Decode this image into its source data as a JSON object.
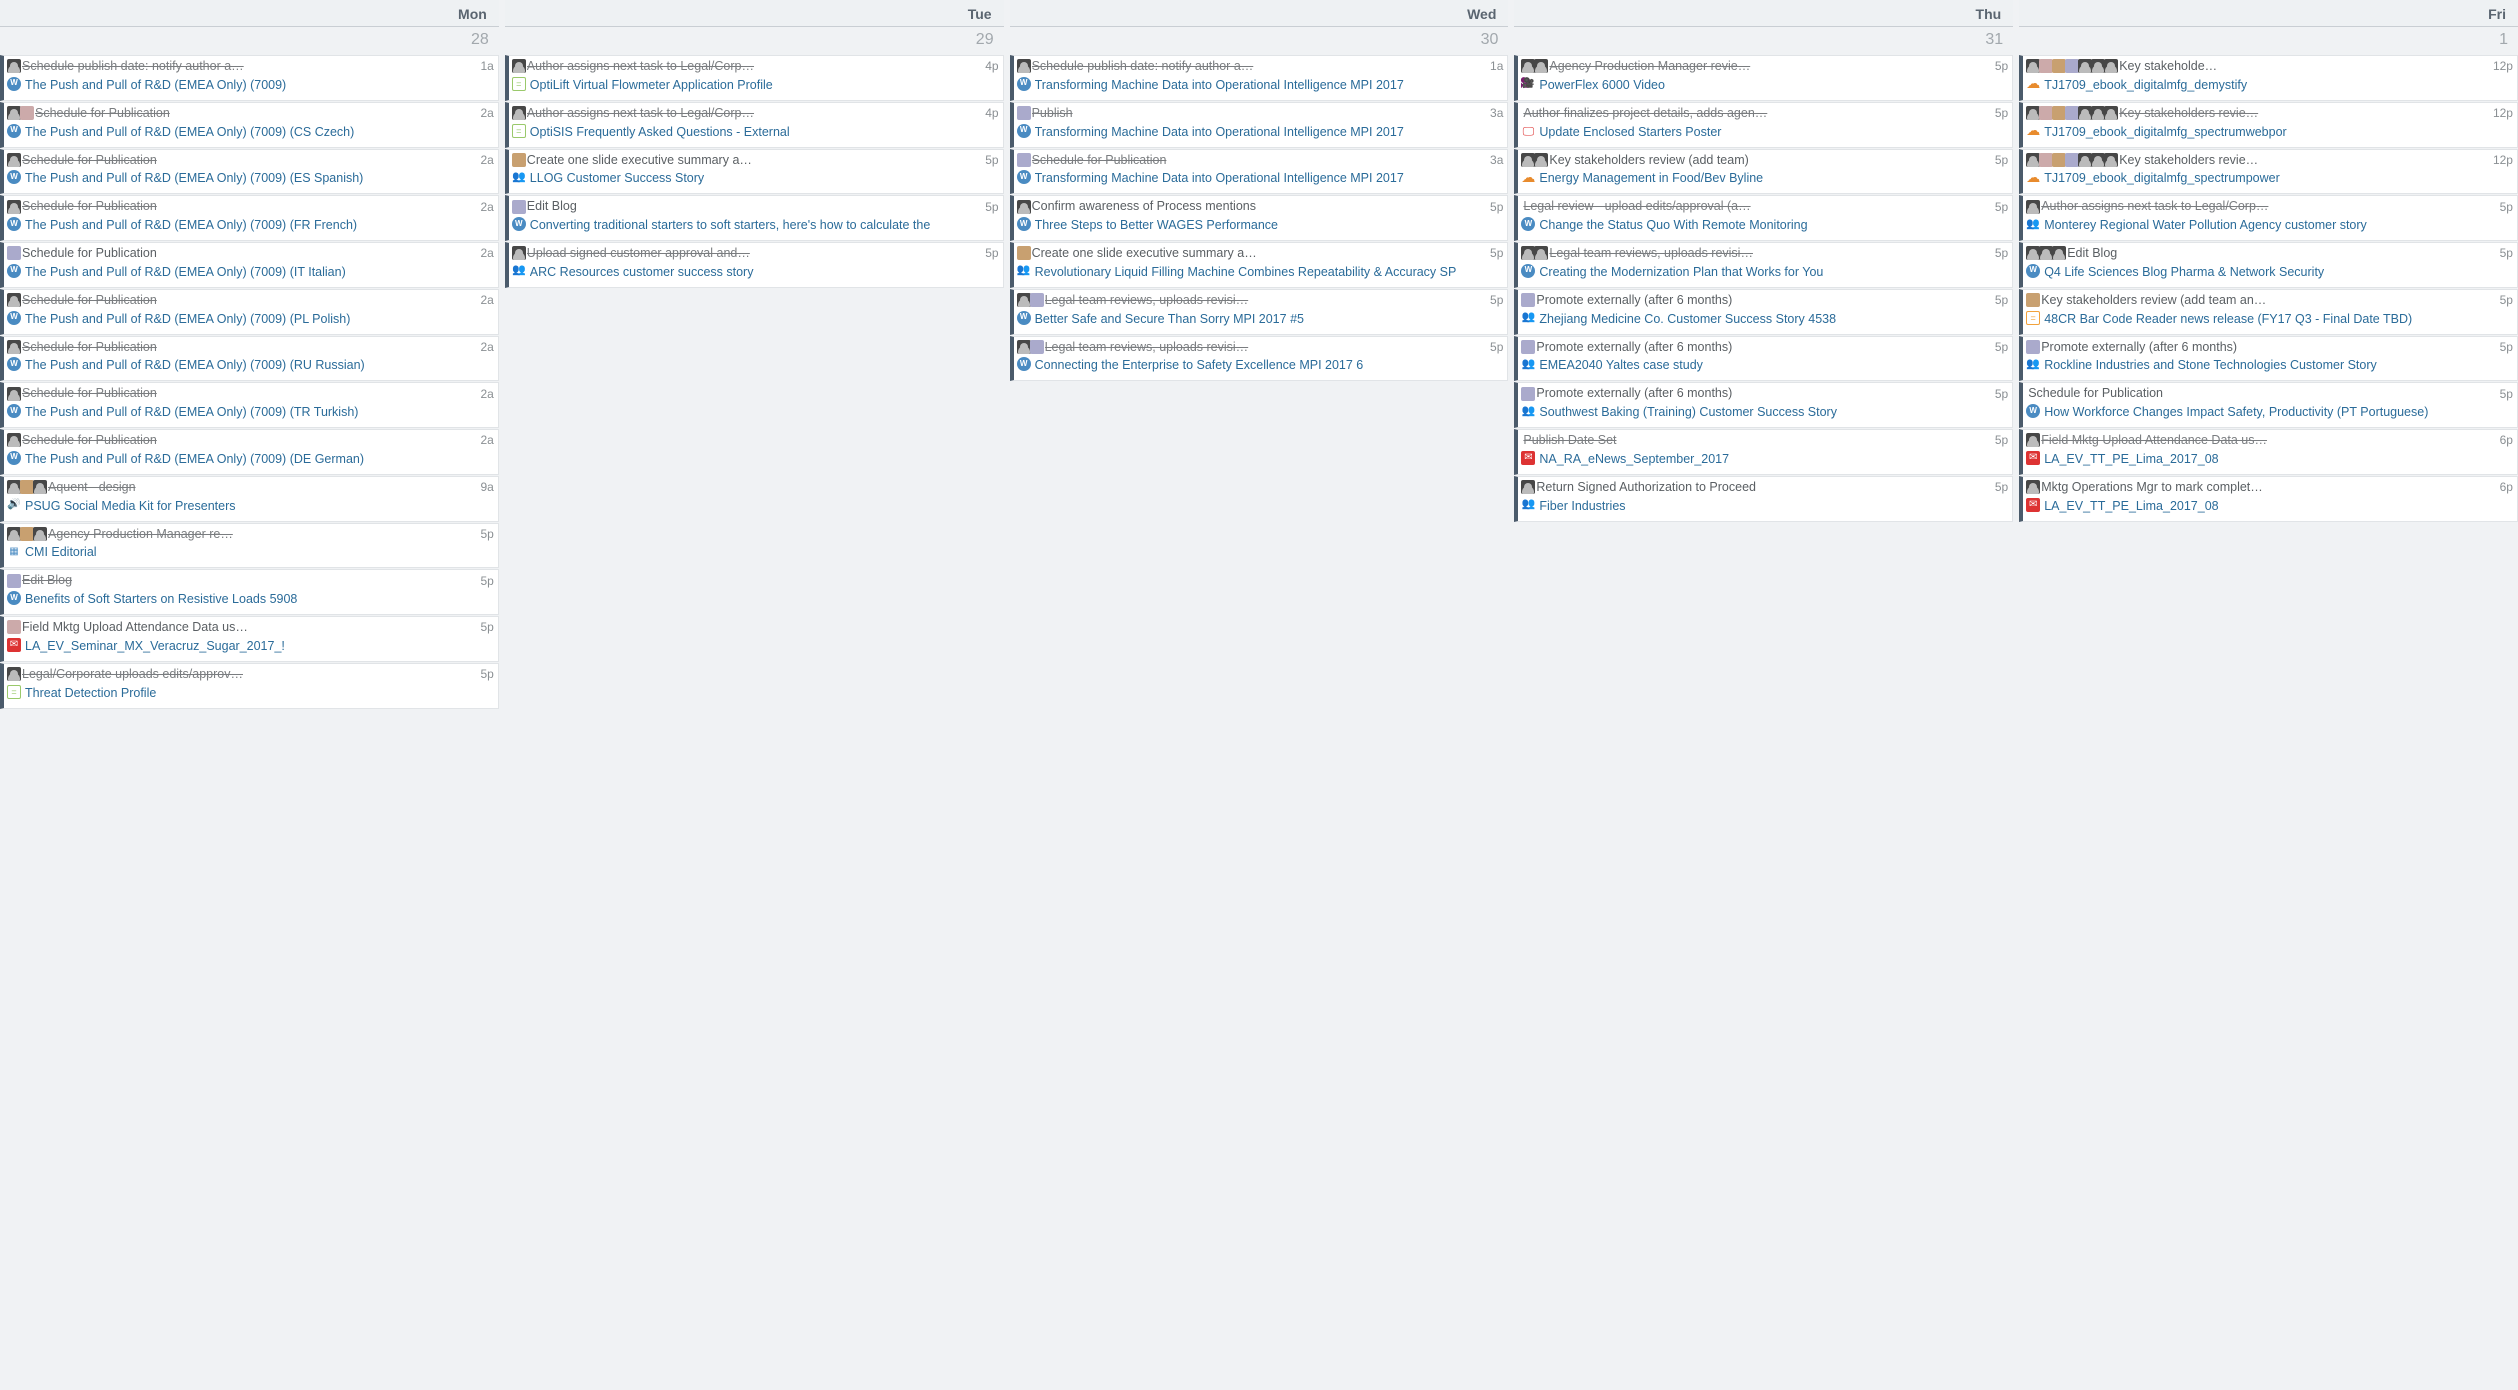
{
  "days": [
    {
      "name": "Mon",
      "date": "28",
      "events": [
        {
          "avatars": [
            "avph"
          ],
          "title": "Schedule publish date: notify author a…",
          "struck": true,
          "time": "1a",
          "sub_icon": "ic-wp",
          "sub": "The Push and Pull of R&D (EMEA Only) (7009)"
        },
        {
          "avatars": [
            "avph",
            "av2"
          ],
          "title": "Schedule for Publication",
          "struck": true,
          "time": "2a",
          "sub_icon": "ic-wp",
          "sub": "The Push and Pull of R&D (EMEA Only) (7009) (CS Czech)"
        },
        {
          "avatars": [
            "avph"
          ],
          "title": "Schedule for Publication",
          "struck": true,
          "time": "2a",
          "sub_icon": "ic-wp",
          "sub": "The Push and Pull of R&D (EMEA Only) (7009) (ES Spanish)"
        },
        {
          "avatars": [
            "avph"
          ],
          "title": "Schedule for Publication",
          "struck": true,
          "time": "2a",
          "sub_icon": "ic-wp",
          "sub": "The Push and Pull of R&D (EMEA Only) (7009) (FR French)"
        },
        {
          "avatars": [
            "av3"
          ],
          "title": "Schedule for Publication",
          "struck": false,
          "time": "2a",
          "sub_icon": "ic-wp",
          "sub": "The Push and Pull of R&D (EMEA Only) (7009) (IT Italian)"
        },
        {
          "avatars": [
            "avph"
          ],
          "title": "Schedule for Publication",
          "struck": true,
          "time": "2a",
          "sub_icon": "ic-wp",
          "sub": "The Push and Pull of R&D (EMEA Only) (7009) (PL Polish)"
        },
        {
          "avatars": [
            "avph"
          ],
          "title": "Schedule for Publication",
          "struck": true,
          "time": "2a",
          "sub_icon": "ic-wp",
          "sub": "The Push and Pull of R&D (EMEA Only) (7009) (RU Russian)"
        },
        {
          "avatars": [
            "avph"
          ],
          "title": "Schedule for Publication",
          "struck": true,
          "time": "2a",
          "sub_icon": "ic-wp",
          "sub": "The Push and Pull of R&D (EMEA Only) (7009) (TR Turkish)"
        },
        {
          "avatars": [
            "avph"
          ],
          "title": "Schedule for Publication",
          "struck": true,
          "time": "2a",
          "sub_icon": "ic-wp",
          "sub": "The Push and Pull of R&D (EMEA Only) (7009) (DE German)"
        },
        {
          "avatars": [
            "avph",
            "av5",
            "avph"
          ],
          "title": "Aquent - design",
          "struck": true,
          "time": "9a",
          "sub_icon": "ic-sound",
          "sub": "PSUG Social Media Kit for Presenters"
        },
        {
          "avatars": [
            "avph",
            "av5",
            "avph"
          ],
          "title": "Agency Production Manager re…",
          "struck": true,
          "time": "5p",
          "sub_icon": "ic-cal",
          "sub": "CMI Editorial"
        },
        {
          "avatars": [
            "av3"
          ],
          "title": "Edit Blog",
          "struck": true,
          "time": "5p",
          "sub_icon": "ic-wp",
          "sub": "Benefits of Soft Starters on Resistive Loads 5908"
        },
        {
          "avatars": [
            "av2"
          ],
          "title": "Field Mktg Upload Attendance Data us…",
          "struck": false,
          "time": "5p",
          "sub_icon": "ic-mail",
          "sub": "LA_EV_Seminar_MX_Veracruz_Sugar_2017_!"
        },
        {
          "avatars": [
            "avph"
          ],
          "title": "Legal/Corporate uploads edits/approv…",
          "struck": true,
          "time": "5p",
          "sub_icon": "ic-doc",
          "sub": "Threat Detection Profile"
        }
      ]
    },
    {
      "name": "Tue",
      "date": "29",
      "events": [
        {
          "avatars": [
            "avph"
          ],
          "title": "Author assigns next task to Legal/Corp…",
          "struck": true,
          "time": "4p",
          "sub_icon": "ic-doc",
          "sub": "OptiLift Virtual Flowmeter Application Profile"
        },
        {
          "avatars": [
            "avph"
          ],
          "title": "Author assigns next task to Legal/Corp…",
          "struck": true,
          "time": "4p",
          "sub_icon": "ic-doc",
          "sub": "OptiSIS Frequently Asked Questions - External"
        },
        {
          "avatars": [
            "av5"
          ],
          "title": "Create one slide executive summary a…",
          "struck": false,
          "time": "5p",
          "sub_icon": "ic-group",
          "sub": "LLOG Customer Success Story"
        },
        {
          "avatars": [
            "av3"
          ],
          "title": "Edit Blog",
          "struck": false,
          "time": "5p",
          "sub_icon": "ic-wp",
          "sub": "Converting traditional starters to soft starters, here's how to calculate the"
        },
        {
          "avatars": [
            "avph"
          ],
          "title": "Upload signed customer approval and…",
          "struck": true,
          "time": "5p",
          "sub_icon": "ic-group",
          "sub": "ARC Resources customer success story"
        }
      ]
    },
    {
      "name": "Wed",
      "date": "30",
      "events": [
        {
          "avatars": [
            "avph"
          ],
          "title": "Schedule publish date: notify author a…",
          "struck": true,
          "time": "1a",
          "sub_icon": "ic-wp",
          "sub": "Transforming Machine Data into Operational Intelligence MPI 2017"
        },
        {
          "avatars": [
            "av3"
          ],
          "title": "Publish",
          "struck": true,
          "time": "3a",
          "sub_icon": "ic-wp",
          "sub": "Transforming Machine Data into Operational Intelligence MPI 2017"
        },
        {
          "avatars": [
            "av3"
          ],
          "title": "Schedule for Publication",
          "struck": true,
          "time": "3a",
          "sub_icon": "ic-wp",
          "sub": "Transforming Machine Data into Operational Intelligence MPI 2017"
        },
        {
          "avatars": [
            "avph"
          ],
          "title": "Confirm awareness of Process mentions",
          "struck": false,
          "time": "5p",
          "sub_icon": "ic-wp",
          "sub": "Three Steps to Better WAGES Performance"
        },
        {
          "avatars": [
            "av5"
          ],
          "title": "Create one slide executive summary a…",
          "struck": false,
          "time": "5p",
          "sub_icon": "ic-group",
          "sub": "Revolutionary Liquid Filling Machine Combines Repeatability & Accuracy SP"
        },
        {
          "avatars": [
            "avph",
            "av3"
          ],
          "title": "Legal team reviews, uploads revisi…",
          "struck": true,
          "time": "5p",
          "sub_icon": "ic-wp",
          "sub": "Better Safe and Secure Than Sorry MPI 2017 #5"
        },
        {
          "avatars": [
            "avph",
            "av3"
          ],
          "title": "Legal team reviews, uploads revisi…",
          "struck": true,
          "time": "5p",
          "sub_icon": "ic-wp",
          "sub": "Connecting the Enterprise to Safety Excellence MPI 2017 6"
        }
      ]
    },
    {
      "name": "Thu",
      "date": "31",
      "events": [
        {
          "avatars": [
            "avph",
            "avph"
          ],
          "title": "Agency Production Manager revie…",
          "struck": true,
          "time": "5p",
          "sub_icon": "ic-video",
          "sub": "PowerFlex 6000 Video"
        },
        {
          "avatars": [],
          "title": "Author finalizes project details, adds agen…",
          "struck": true,
          "time": "5p",
          "sub_icon": "ic-screen",
          "sub": "Update Enclosed Starters Poster"
        },
        {
          "avatars": [
            "avph",
            "avph"
          ],
          "title": "Key stakeholders review (add team)",
          "struck": false,
          "time": "5p",
          "sub_icon": "ic-cloud",
          "sub": "Energy Management in Food/Bev Byline"
        },
        {
          "avatars": [],
          "title": "Legal review - upload edits/approval (a…",
          "struck": true,
          "time": "5p",
          "sub_icon": "ic-wp",
          "sub": "Change the Status Quo With Remote Monitoring"
        },
        {
          "avatars": [
            "avph",
            "avph"
          ],
          "title": "Legal team reviews, uploads revisi…",
          "struck": true,
          "time": "5p",
          "sub_icon": "ic-wp",
          "sub": "Creating the Modernization Plan that Works for You"
        },
        {
          "avatars": [
            "av3"
          ],
          "title": "Promote externally (after 6 months)",
          "struck": false,
          "time": "5p",
          "sub_icon": "ic-group",
          "sub": "Zhejiang Medicine Co. Customer Success Story 4538"
        },
        {
          "avatars": [
            "av3"
          ],
          "title": "Promote externally (after 6 months)",
          "struck": false,
          "time": "5p",
          "sub_icon": "ic-group",
          "sub": "EMEA2040 Yaltes case study"
        },
        {
          "avatars": [
            "av3"
          ],
          "title": "Promote externally (after 6 months)",
          "struck": false,
          "time": "5p",
          "sub_icon": "ic-group",
          "sub": "Southwest Baking (Training) Customer Success Story"
        },
        {
          "avatars": [],
          "title": "Publish Date Set",
          "struck": true,
          "time": "5p",
          "sub_icon": "ic-mail",
          "sub": "NA_RA_eNews_September_2017"
        },
        {
          "avatars": [
            "avph"
          ],
          "title": "Return Signed Authorization to Proceed",
          "struck": false,
          "time": "5p",
          "sub_icon": "ic-group",
          "sub": "Fiber Industries"
        }
      ]
    },
    {
      "name": "Fri",
      "date": "1",
      "events": [
        {
          "avatars": [
            "avph",
            "av2",
            "av5",
            "av3",
            "avph",
            "avph",
            "avph"
          ],
          "title": "Key stakeholde…",
          "struck": false,
          "time": "12p",
          "sub_icon": "ic-cloud",
          "sub": "TJ1709_ebook_digitalmfg_demystify"
        },
        {
          "avatars": [
            "avph",
            "av2",
            "av5",
            "av3",
            "avph",
            "avph",
            "avph"
          ],
          "title": "Key stakeholders revie…",
          "struck": true,
          "time": "12p",
          "sub_icon": "ic-cloud",
          "sub": "TJ1709_ebook_digitalmfg_spectrumwebpor"
        },
        {
          "avatars": [
            "avph",
            "av2",
            "av5",
            "av3",
            "avph",
            "avph",
            "avph"
          ],
          "title": "Key stakeholders revie…",
          "struck": false,
          "time": "12p",
          "sub_icon": "ic-cloud",
          "sub": "TJ1709_ebook_digitalmfg_spectrumpower"
        },
        {
          "avatars": [
            "avph"
          ],
          "title": "Author assigns next task to Legal/Corp…",
          "struck": true,
          "time": "5p",
          "sub_icon": "ic-group",
          "sub": "Monterey Regional Water Pollution Agency customer story"
        },
        {
          "avatars": [
            "avph",
            "avph",
            "avph"
          ],
          "title": "Edit Blog",
          "struck": false,
          "time": "5p",
          "sub_icon": "ic-wp",
          "sub": "Q4 Life Sciences Blog Pharma & Network Security"
        },
        {
          "avatars": [
            "av5"
          ],
          "title": "Key stakeholders review (add team an…",
          "struck": false,
          "time": "5p",
          "sub_icon": "ic-doc-o",
          "sub": "48CR Bar Code Reader news release (FY17 Q3 - Final Date TBD)"
        },
        {
          "avatars": [
            "av3"
          ],
          "title": "Promote externally (after 6 months)",
          "struck": false,
          "time": "5p",
          "sub_icon": "ic-group",
          "sub": "Rockline Industries and Stone Technologies Customer Story"
        },
        {
          "avatars": [],
          "title": "Schedule for Publication",
          "struck": false,
          "time": "5p",
          "sub_icon": "ic-wp",
          "sub": "How Workforce Changes Impact Safety, Productivity (PT Portuguese)"
        },
        {
          "avatars": [
            "avph"
          ],
          "title": "Field Mktg Upload Attendance Data us…",
          "struck": true,
          "time": "6p",
          "sub_icon": "ic-mail",
          "sub": "LA_EV_TT_PE_Lima_2017_08"
        },
        {
          "avatars": [
            "avph"
          ],
          "title": "Mktg Operations Mgr to mark complet…",
          "struck": false,
          "time": "6p",
          "sub_icon": "ic-mail",
          "sub": "LA_EV_TT_PE_Lima_2017_08"
        }
      ]
    }
  ]
}
